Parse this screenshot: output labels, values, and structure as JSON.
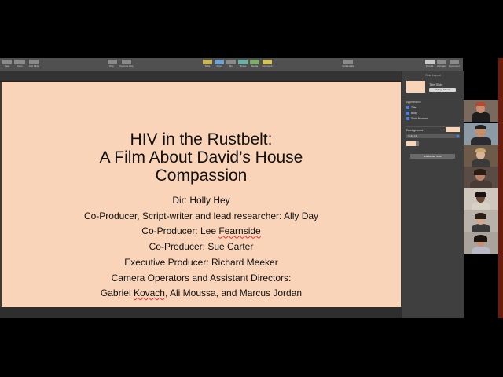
{
  "toolbar": {
    "items": [
      {
        "icon": "view-icon",
        "label": "View"
      },
      {
        "icon": "zoom-icon",
        "label": "Zoom"
      },
      {
        "icon": "add-slide-icon",
        "label": "Add Slide"
      },
      {
        "icon": "play-icon",
        "label": "Play"
      },
      {
        "icon": "keynote-live-icon",
        "label": "Keynote Live"
      },
      {
        "icon": "table-icon",
        "label": "Table"
      },
      {
        "icon": "chart-icon",
        "label": "Chart"
      },
      {
        "icon": "text-icon",
        "label": "Text"
      },
      {
        "icon": "shape-icon",
        "label": "Shape"
      },
      {
        "icon": "media-icon",
        "label": "Media"
      },
      {
        "icon": "comment-icon",
        "label": "Comment"
      },
      {
        "icon": "collaborate-icon",
        "label": "Collaborate"
      },
      {
        "icon": "format-icon",
        "label": "Format"
      },
      {
        "icon": "animate-icon",
        "label": "Animate"
      },
      {
        "icon": "document-icon",
        "label": "Document"
      }
    ]
  },
  "slide": {
    "title": "HIV in the Rustbelt:\nA Film About David’s House\nCompassion",
    "credits": {
      "dir": "Dir: Holly Hey",
      "coproducer1": "Co-Producer, Script-writer and lead researcher: Ally Day",
      "coproducer2_prefix": "Co-Producer: Lee ",
      "coproducer2_name": "Fearnside",
      "coproducer3": "Co-Producer: Sue Carter",
      "exec": "Executive Producer: Richard Meeker",
      "camera_heading": "Camera Operators and Assistant Directors:",
      "camera_first": "Gabriel ",
      "camera_misspelled": "Kovach",
      "camera_rest": ", Ali Moussa, and Marcus Jordan"
    },
    "background_color": "#f9d4b9"
  },
  "inspector": {
    "header": "Slide Layout",
    "layout_name": "Title Slide",
    "change_master": "Change Master",
    "appearance_label": "Appearance",
    "checkboxes": [
      "Title",
      "Body",
      "Slide Number"
    ],
    "background_label": "Background",
    "fill_option": "Color Fill",
    "edit_master": "Edit Master Slide"
  },
  "participants": [
    {
      "name": "participant-1"
    },
    {
      "name": "participant-2"
    },
    {
      "name": "participant-3"
    },
    {
      "name": "participant-4"
    },
    {
      "name": "participant-5"
    },
    {
      "name": "participant-6"
    },
    {
      "name": "participant-7"
    }
  ]
}
